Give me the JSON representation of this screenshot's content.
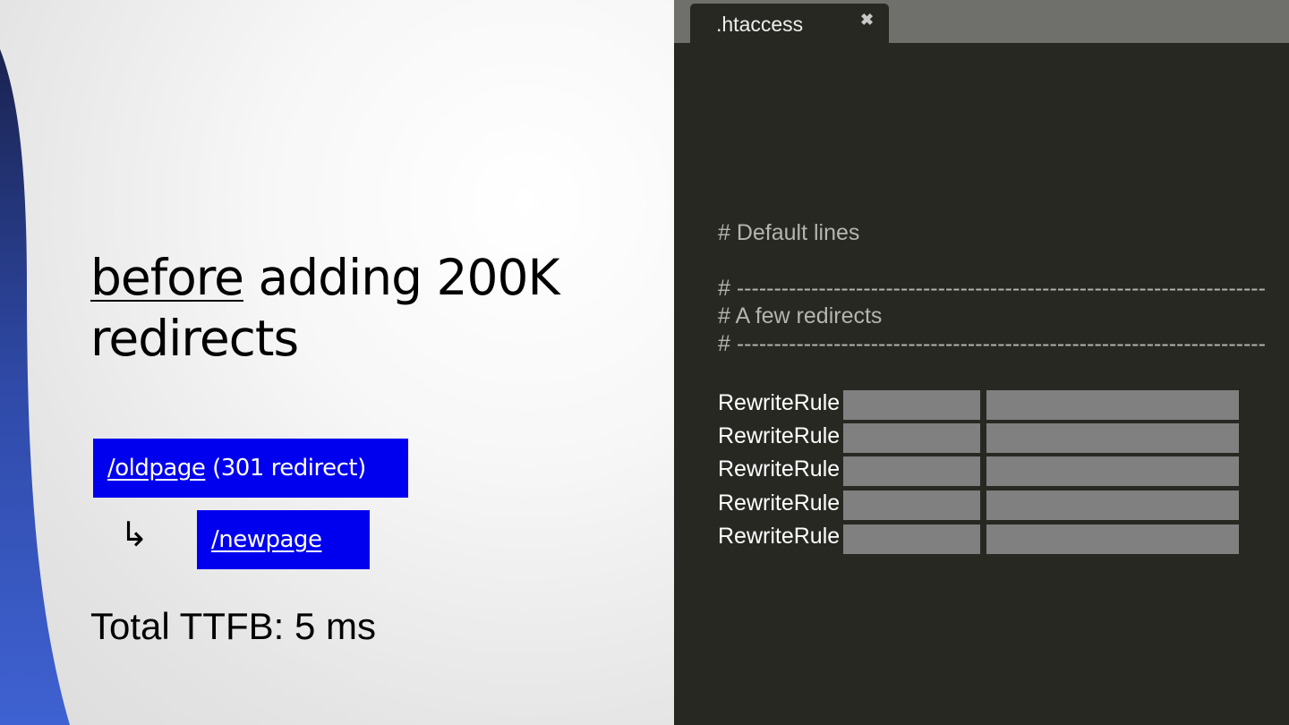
{
  "slide": {
    "title_underlined": "before",
    "title_rest": " adding 200K redirects",
    "redirect_from": {
      "link": "/oldpage",
      "suffix": " (301 redirect)"
    },
    "redirect_arrow": "↳",
    "redirect_to": {
      "link": "/newpage"
    },
    "ttfb": "Total TTFB: 5 ms"
  },
  "editor": {
    "tab_label": ".htaccess",
    "tab_close": "✖",
    "comments": {
      "default": "# Default lines",
      "sep1": "# -----------------------------------------------------------------------",
      "few": "# A few redirects",
      "sep2": "# -----------------------------------------------------------------------"
    },
    "rules": [
      {
        "keyword": "RewriteRule"
      },
      {
        "keyword": "RewriteRule"
      },
      {
        "keyword": "RewriteRule"
      },
      {
        "keyword": "RewriteRule"
      },
      {
        "keyword": "RewriteRule"
      }
    ]
  },
  "colors": {
    "link_box": "#0000ee",
    "editor_bg": "#272822",
    "redacted": "#808080"
  }
}
